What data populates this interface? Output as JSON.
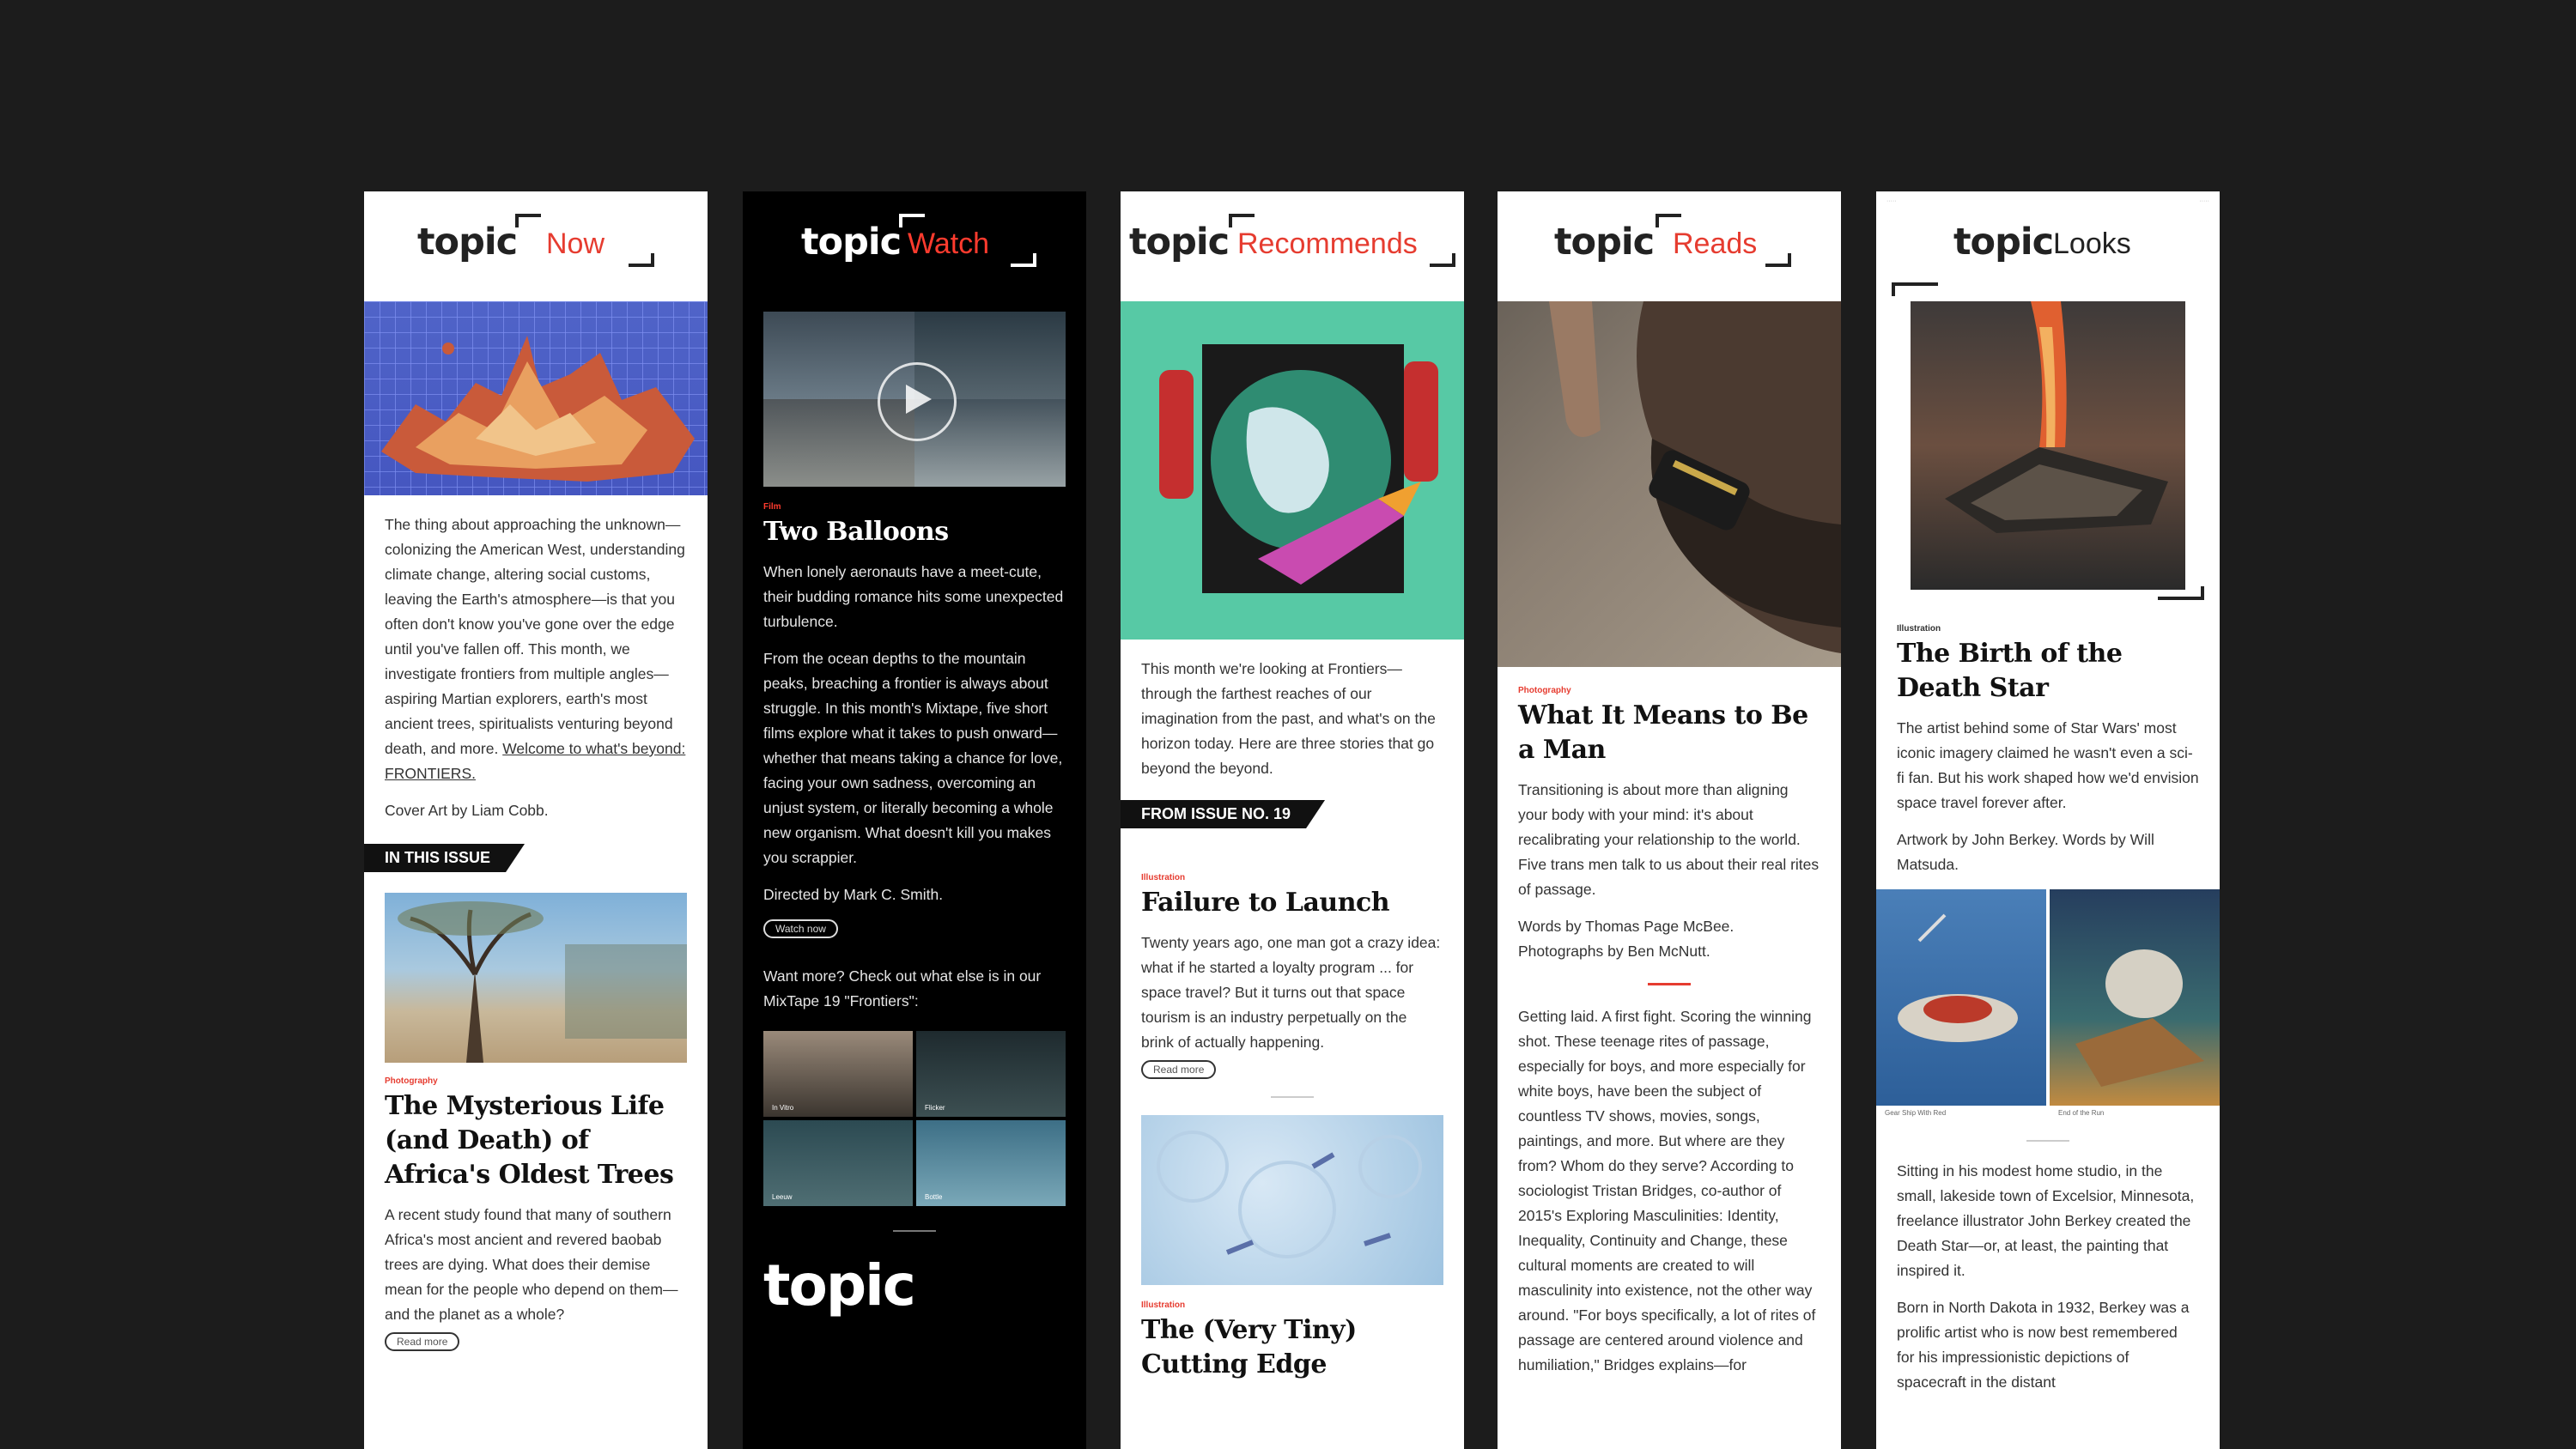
{
  "colors": {
    "accent": "#e63c30",
    "background": "#1c1c1c"
  },
  "col1": {
    "logo": "topic",
    "section": "Now",
    "intro": "The thing about approaching the unknown—colonizing the American West, understanding climate change, altering social customs, leaving the Earth's atmosphere—is that you often don't know you've gone over the edge until you've fallen off. This month, we investigate frontiers from multiple angles—aspiring Martian explorers, earth's most ancient trees, spiritualists venturing beyond death, and more.",
    "link": "Welcome to what's beyond: FRONTIERS.",
    "cover_credit": "Cover Art by Liam Cobb.",
    "banner": "IN THIS ISSUE",
    "kicker": "Photography",
    "title": "The Mysterious Life (and Death) of Africa's Oldest Trees",
    "summary": "A recent study found that many of southern Africa's most ancient and revered baobab trees are dying. What does their demise mean for the people who depend on them—and the planet as a whole?",
    "button": "Read more"
  },
  "col2": {
    "logo": "topic",
    "section": "Watch",
    "kicker": "Film",
    "title": "Two Balloons",
    "p1": "When lonely aeronauts have a meet-cute, their budding romance hits some unexpected turbulence.",
    "p2": "From the ocean depths to the mountain peaks, breaching a frontier is always about struggle. In this month's Mixtape, five short films explore what it takes to push onward—whether that means taking a chance for love, facing your own sadness, overcoming an unjust system, or literally becoming a whole new organism. What doesn't kill you makes you scrappier.",
    "director": "Directed by Mark C. Smith.",
    "button": "Watch now",
    "more": "Want more? Check out what else is in our MixTape 19 \"Frontiers\":",
    "thumbs": [
      "In Vitro",
      "Flicker",
      "Leeuw",
      "Bottle"
    ],
    "footer_logo": "topic"
  },
  "col3": {
    "logo": "topic",
    "section": "Recommends",
    "intro": "This month we're looking at Frontiers—through the farthest reaches of our imagination from the past, and what's on the horizon today. Here are three stories that go beyond the beyond.",
    "banner": "FROM ISSUE NO. 19",
    "kicker1": "Illustration",
    "title1": "Failure to Launch",
    "summary1": "Twenty years ago, one man got a crazy idea: what if he started a loyalty program ... for space travel? But it turns out that space tourism is an industry perpetually on the brink of actually happening.",
    "button": "Read more",
    "kicker2": "Illustration",
    "title2": "The (Very Tiny) Cutting Edge"
  },
  "col4": {
    "logo": "topic",
    "section": "Reads",
    "kicker": "Photography",
    "title": "What It Means to Be a Man",
    "summary": "Transitioning is about more than aligning your body with your mind: it's about recalibrating your relationship to the world. Five trans men talk to us about their real rites of passage.",
    "credits": "Words by Thomas Page McBee. Photographs by Ben McNutt.",
    "body": "Getting laid. A first fight. Scoring the winning shot. These teenage rites of passage, especially for boys, and more especially for white boys, have been the subject of countless TV shows, movies, songs, paintings, and more. But where are they from? Whom do they serve? According to sociologist Tristan Bridges, co-author of 2015's Exploring Masculinities: Identity, Inequality, Continuity and Change, these cultural moments are created to will masculinity into existence, not the other way around. \"For boys specifically, a lot of rites of passage are centered around violence and humiliation,\" Bridges explains—for"
  },
  "col5": {
    "logo": "topic",
    "section": "Looks",
    "kicker": "Illustration",
    "title": "The Birth of the Death Star",
    "summary": "The artist behind some of Star Wars' most iconic imagery claimed he wasn't even a sci-fi fan. But his work shaped how we'd envision space travel forever after.",
    "credits": "Artwork by John Berkey. Words by Will Matsuda.",
    "caption1": "Gear Ship With Red",
    "caption2": "End of the Run",
    "p1": "Sitting in his modest home studio, in the small, lakeside town of Excelsior, Minnesota, freelance illustrator John Berkey created the Death Star—or, at least, the painting that inspired it.",
    "p2": "Born in North Dakota in 1932, Berkey was a prolific artist who is now best remembered for his impressionistic depictions of spacecraft in the distant"
  }
}
